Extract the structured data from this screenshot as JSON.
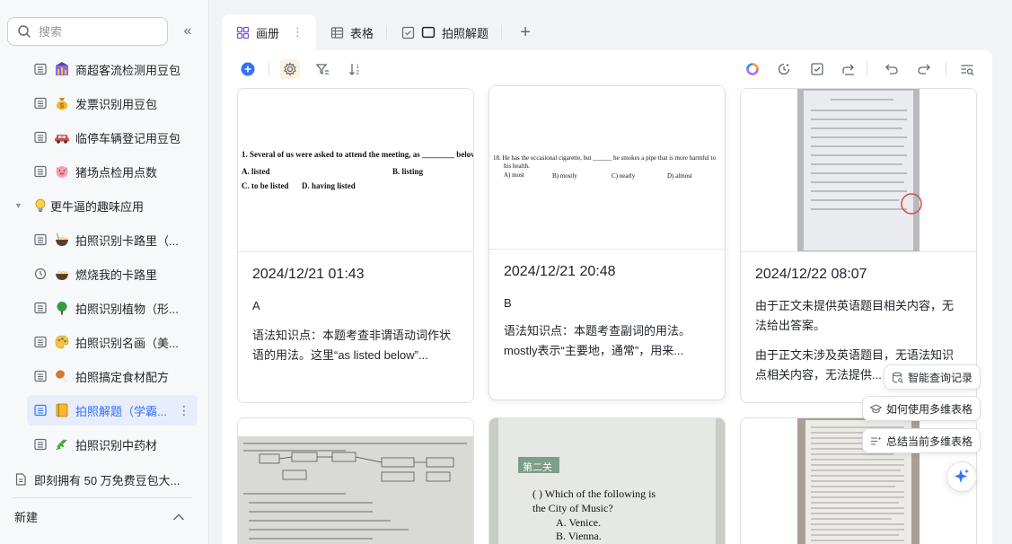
{
  "sidebar": {
    "search_placeholder": "搜索",
    "items": [
      {
        "label": "商超客流检测用豆包",
        "icon": "store-chart-icon",
        "emoji": "🏪"
      },
      {
        "label": "发票识别用豆包",
        "icon": "money-bag-icon",
        "emoji": "💰"
      },
      {
        "label": "临停车辆登记用豆包",
        "icon": "car-icon",
        "emoji": "🚗"
      },
      {
        "label": "猪场点检用点数",
        "icon": "pig-icon",
        "emoji": "🐷"
      },
      {
        "label": "更牛逼的趣味应用",
        "icon": "lightbulb-icon",
        "emoji": "💡"
      },
      {
        "label": "拍照识别卡路里（...",
        "icon": "noodle-bowl-icon",
        "emoji": "🍜"
      },
      {
        "label": "燃烧我的卡路里",
        "icon": "noodle-bowl-icon",
        "emoji": "🍜"
      },
      {
        "label": "拍照识别植物（形...",
        "icon": "tree-icon",
        "emoji": "🌳"
      },
      {
        "label": "拍照识别名画（美...",
        "icon": "palette-icon",
        "emoji": "🎨"
      },
      {
        "label": "拍照搞定食材配方",
        "icon": "drumstick-icon",
        "emoji": "🍗"
      },
      {
        "label": "拍照解题（学霸...",
        "icon": "notebook-icon",
        "emoji": "📒"
      },
      {
        "label": "拍照识别中药材",
        "icon": "herb-icon",
        "emoji": "🌿"
      },
      {
        "label": "即刻拥有 50 万免费豆包大..."
      }
    ],
    "new_label": "新建"
  },
  "tabs": [
    {
      "label": "画册"
    },
    {
      "label": "表格"
    },
    {
      "label": "拍照解题"
    }
  ],
  "cards": [
    {
      "date": "2024/12/21 01:43",
      "answer": "A",
      "analysis": "语法知识点：本题考查非谓语动词作状语的用法。这里“as listed below”...",
      "question_lines": [
        "1.  Several of us were asked to attend the meeting, as ________ below.",
        "A.  listed",
        "B.  listing",
        "C.  to be listed",
        "D.  having listed"
      ]
    },
    {
      "date": "2024/12/21 20:48",
      "answer": "B",
      "analysis": "语法知识点：本题考查副词的用法。mostly表示“主要地，通常”，用来...",
      "question_lines": [
        "18.  He has the occasional cigarette, but ______ he smokes a pipe that is more harmful to",
        "his health.",
        "A) most",
        "B) mostly",
        "C) nearly",
        "D) almost"
      ]
    },
    {
      "date": "2024/12/22 08:07",
      "answer": "由于正文未提供英语题目相关内容，无法给出答案。",
      "analysis": "由于正文未涉及英语题目，无语法知识点相关内容，无法提供..."
    },
    {
      "question_lines": [
        "第二关",
        "(    ) Which of the following is",
        "the City of Music?",
        "A. Venice.",
        "B. Vienna."
      ]
    }
  ],
  "floating": {
    "smart_query": "智能查询记录",
    "how_to_use": "如何使用多维表格",
    "summarize": "总结当前多维表格"
  },
  "colors": {
    "accent": "#3370ff",
    "active_bg": "#e8edfb",
    "selected_tool_bg": "#fdf2e0"
  }
}
